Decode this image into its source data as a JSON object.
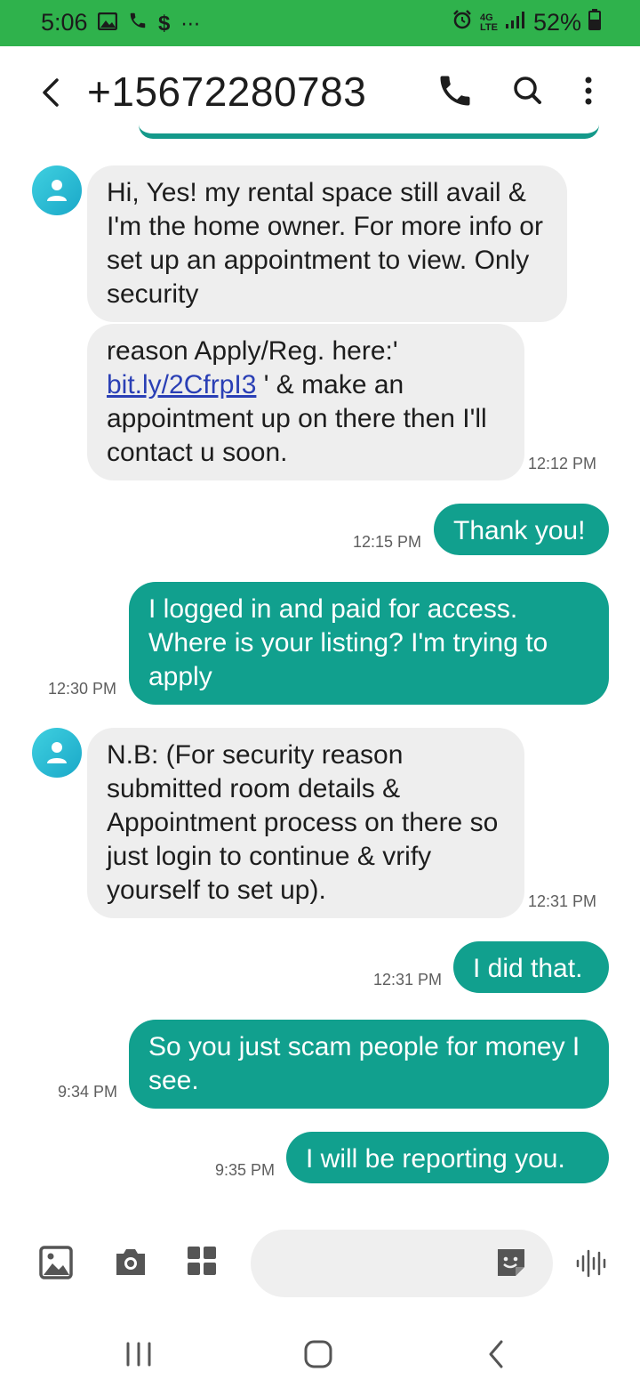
{
  "status_bar": {
    "time": "5:06",
    "battery": "52%",
    "left_icons": [
      "gallery-icon",
      "phone-icon",
      "dollar-icon",
      "more-dots-icon"
    ],
    "right_icons": [
      "alarm-icon",
      "lte-icon",
      "signal-icon",
      "battery-icon"
    ],
    "background": "#2fb24c"
  },
  "header": {
    "title": "+15672280783",
    "icons": [
      "back-icon",
      "call-icon",
      "search-icon",
      "more-vert-icon"
    ]
  },
  "messages": [
    {
      "dir": "in",
      "parts": [
        {
          "text": "Hi, Yes! my rental space still avail & I'm the home owner. For more info or set up an appointment to view. Only security"
        }
      ],
      "time": ""
    },
    {
      "dir": "in",
      "parts": [
        {
          "text": "reason Apply/Reg. here:' "
        },
        {
          "text": "bit.ly/2CfrpI3",
          "link": true
        },
        {
          "text": " ' & make an appointment up on there then I'll contact u soon."
        }
      ],
      "time": "12:12 PM"
    },
    {
      "dir": "out",
      "parts": [
        {
          "text": "Thank you!"
        }
      ],
      "time": "12:15 PM"
    },
    {
      "dir": "out",
      "parts": [
        {
          "text": "I logged in and paid for access. Where is your listing? I'm trying to apply"
        }
      ],
      "time": "12:30 PM"
    },
    {
      "dir": "in",
      "parts": [
        {
          "text": "N.B: (For security reason submitted room details & Appointment process on there so just login to continue & vrify yourself to set up)."
        }
      ],
      "time": "12:31 PM"
    },
    {
      "dir": "out",
      "parts": [
        {
          "text": "I did that."
        }
      ],
      "time": "12:31 PM"
    },
    {
      "dir": "out",
      "parts": [
        {
          "text": "So you just scam people for money I see."
        }
      ],
      "time": "9:34 PM"
    },
    {
      "dir": "out",
      "parts": [
        {
          "text": "I will be reporting you."
        }
      ],
      "time": "9:35 PM"
    }
  ],
  "input_bar": {
    "icons": [
      "image-icon",
      "camera-icon",
      "apps-icon",
      "sticker-icon",
      "voice-icon"
    ],
    "placeholder": ""
  },
  "nav_bar": {
    "icons": [
      "recents-icon",
      "home-icon",
      "back-nav-icon"
    ]
  },
  "colors": {
    "outgoing_bubble": "#11a08e",
    "incoming_bubble": "#eeeeee",
    "link": "#2a3fb5"
  }
}
